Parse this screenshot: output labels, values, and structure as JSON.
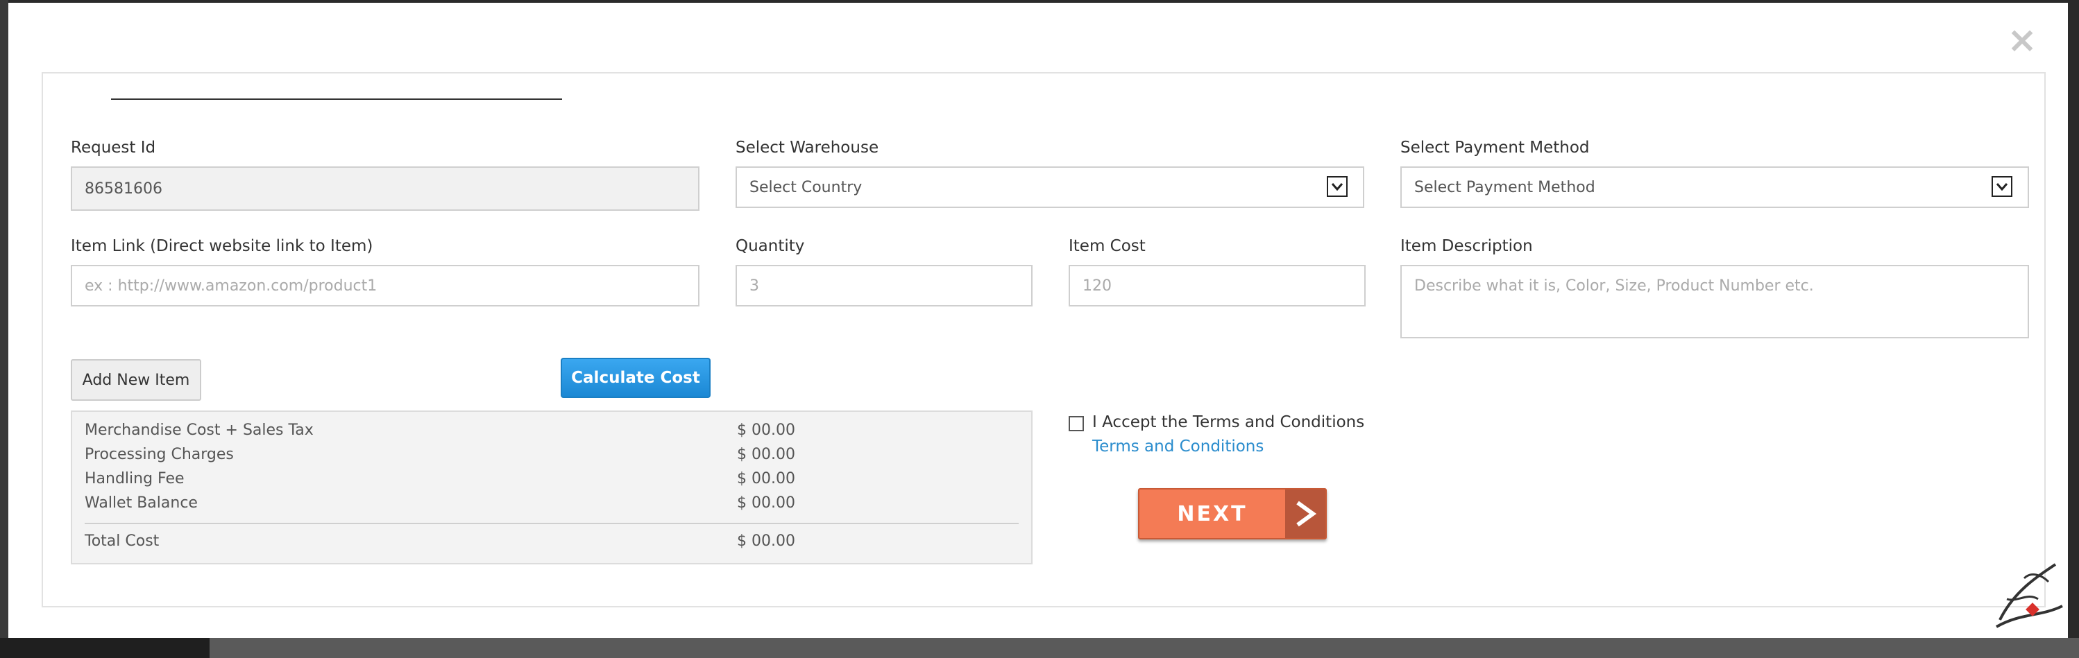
{
  "form": {
    "request_id": {
      "label": "Request Id",
      "value": "86581606"
    },
    "warehouse": {
      "label": "Select Warehouse",
      "selected": "Select Country"
    },
    "payment_method": {
      "label": "Select Payment Method",
      "selected": "Select Payment Method"
    },
    "item_link": {
      "label": "Item Link (Direct website link to Item)",
      "placeholder": "ex : http://www.amazon.com/product1"
    },
    "quantity": {
      "label": "Quantity",
      "placeholder": "3"
    },
    "item_cost": {
      "label": "Item Cost",
      "placeholder": "120"
    },
    "item_description": {
      "label": "Item Description",
      "placeholder": "Describe what it is, Color, Size, Product Number etc."
    }
  },
  "buttons": {
    "add_new_item": "Add New Item",
    "calculate_cost": "Calculate Cost",
    "next": "NEXT",
    "close": "×"
  },
  "summary": {
    "rows": [
      {
        "label": "Merchandise Cost + Sales Tax",
        "value": "$ 00.00"
      },
      {
        "label": "Processing Charges",
        "value": "$ 00.00"
      },
      {
        "label": "Handling Fee",
        "value": "$ 00.00"
      },
      {
        "label": "Wallet Balance",
        "value": "$ 00.00"
      }
    ],
    "total": {
      "label": "Total Cost",
      "value": "$ 00.00"
    }
  },
  "terms": {
    "accept_label": "I Accept the Terms and Conditions",
    "link_label": "Terms and Conditions",
    "checked": false
  },
  "colors": {
    "primary_button": "#1b88d4",
    "next_button": "#f47b55",
    "link": "#2a8ccd"
  },
  "icons": {
    "close": "close-icon",
    "select_arrow": "chevron-down-icon",
    "next_arrow": "chevron-right-icon"
  }
}
